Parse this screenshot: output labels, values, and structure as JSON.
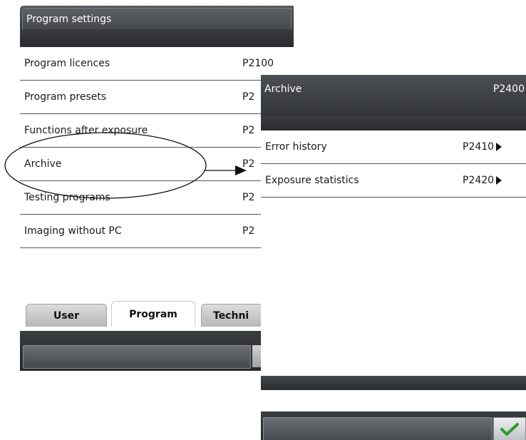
{
  "left_panel": {
    "title": "Program settings",
    "rows": [
      {
        "label": "Program licences",
        "code": "P2100"
      },
      {
        "label": "Program presets",
        "code": "P2"
      },
      {
        "label": "Functions after exposure",
        "code": "P2"
      },
      {
        "label": "Archive",
        "code": "P2"
      },
      {
        "label": "Testing programs",
        "code": "P2"
      },
      {
        "label": "Imaging without PC",
        "code": "P2"
      }
    ],
    "tabs": [
      {
        "label": "User",
        "active": false
      },
      {
        "label": "Program",
        "active": true
      },
      {
        "label": "Techni",
        "active": false
      }
    ]
  },
  "right_panel": {
    "title": "Archive",
    "code": "P2400",
    "rows": [
      {
        "label": "Error history",
        "code": "P2410"
      },
      {
        "label": "Exposure statistics",
        "code": "P2420"
      }
    ],
    "confirm_icon": "checkmark-icon"
  },
  "annotation": {
    "highlight": "Archive",
    "arrow_target": "Archive panel"
  },
  "colors": {
    "header_dark": "#3d4044",
    "row_divider": "#555555",
    "checkmark_green": "#2e9a2a"
  }
}
